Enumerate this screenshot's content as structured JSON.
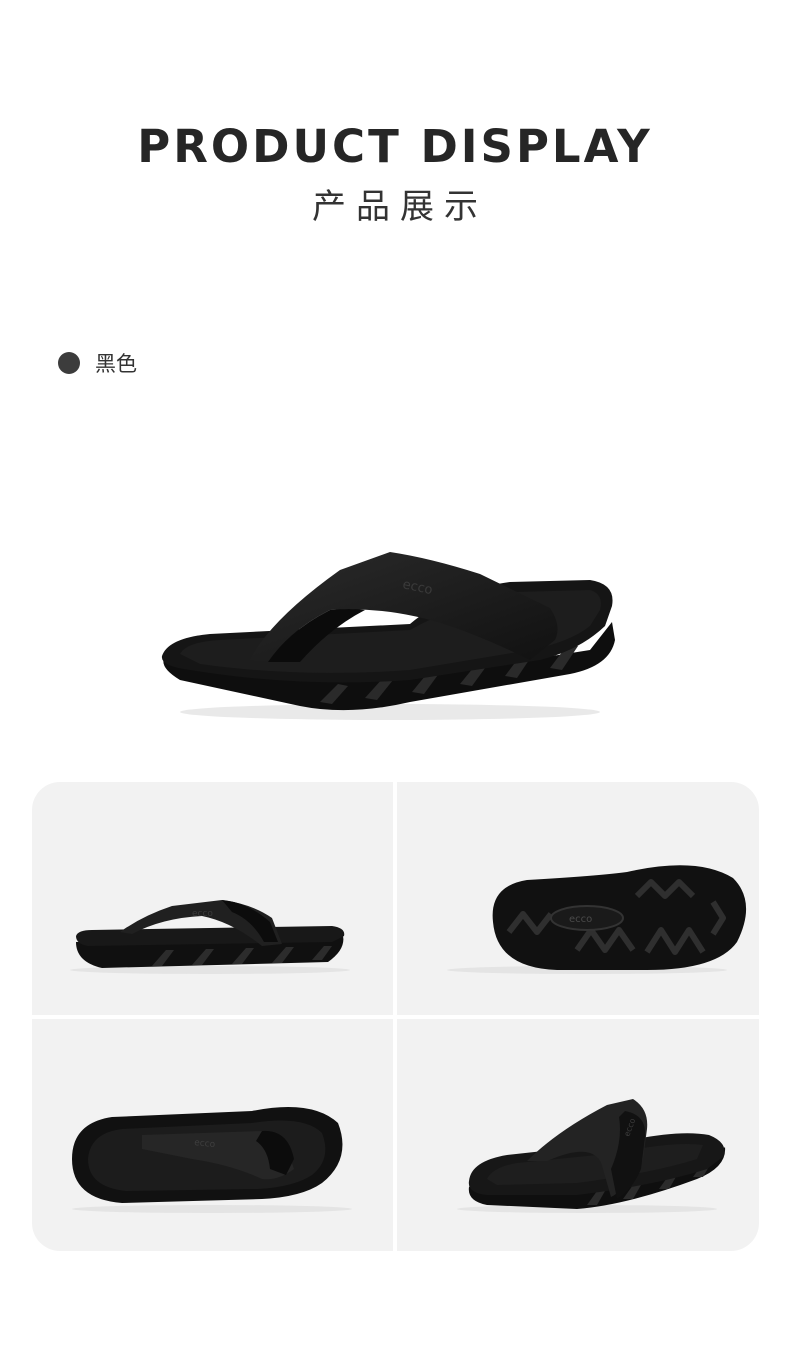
{
  "header": {
    "title_en": "PRODUCT DISPLAY",
    "title_cn": "产品展示"
  },
  "color_option": {
    "label": "黑色",
    "swatch": "#3c3c3c"
  },
  "brand_mark": "ecco",
  "colors": {
    "background": "#ffffff",
    "panel": "#f2f2f2",
    "product": "#1a1a1a"
  },
  "views": [
    "hero-angled-view",
    "side-view",
    "outsole-view",
    "top-view",
    "rear-angled-view"
  ]
}
